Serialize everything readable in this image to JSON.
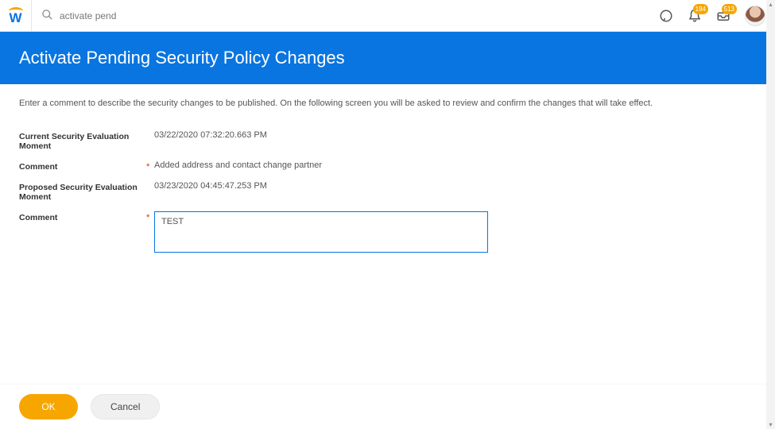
{
  "brand": {
    "letter": "W"
  },
  "search": {
    "value": "activate pend"
  },
  "notifications": {
    "bell_badge": "194",
    "inbox_badge": "513"
  },
  "header": {
    "title": "Activate Pending Security Policy Changes"
  },
  "instructions": "Enter a comment to describe the security changes to be published. On the following screen you will be asked to review and confirm the changes that will take effect.",
  "form": {
    "current_label": "Current Security Evaluation Moment",
    "current_value": "03/22/2020 07:32:20.663 PM",
    "current_comment_label": "Comment",
    "current_comment_value": "Added address and contact change partner",
    "proposed_label": "Proposed Security Evaluation Moment",
    "proposed_value": "03/23/2020 04:45:47.253 PM",
    "proposed_comment_label": "Comment",
    "proposed_comment_value": "TEST"
  },
  "footer": {
    "ok_label": "OK",
    "cancel_label": "Cancel"
  }
}
